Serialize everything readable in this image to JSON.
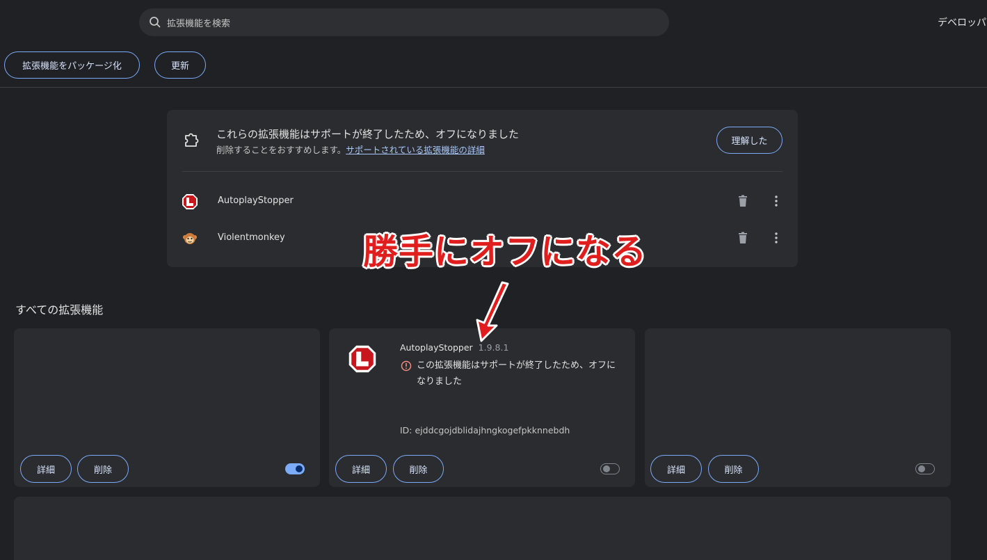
{
  "search": {
    "placeholder": "拡張機能を検索"
  },
  "header": {
    "devmode_label": "デベロッパ"
  },
  "toolbar": {
    "pack_label": "拡張機能をパッケージ化",
    "update_label": "更新"
  },
  "notice": {
    "title": "これらの拡張機能はサポートが終了したため、オフになりました",
    "subtitle": "削除することをおすすめします。",
    "link": "サポートされている拡張機能の詳細",
    "ack_label": "理解した",
    "items": [
      {
        "name": "AutoplayStopper",
        "icon": "autoplaystopper-icon"
      },
      {
        "name": "Violentmonkey",
        "icon": "violentmonkey-icon"
      }
    ]
  },
  "section": {
    "title": "すべての拡張機能"
  },
  "cards": [
    {
      "name": "",
      "version": "",
      "details_label": "詳細",
      "remove_label": "削除",
      "enabled": true
    },
    {
      "name": "AutoplayStopper",
      "version": "1.9.8.1",
      "warning": "この拡張機能はサポートが終了したため、オフになりました",
      "id": "ID: ejddcgojdblidajhngkogefpkknnebdh",
      "details_label": "詳細",
      "remove_label": "削除",
      "enabled": false
    },
    {
      "name": "",
      "version": "",
      "details_label": "詳細",
      "remove_label": "削除",
      "enabled": false
    }
  ],
  "annotation": {
    "text": "勝手にオフになる"
  },
  "colors": {
    "accent": "#7cacf8",
    "background": "#202124",
    "panel": "#2b2c30",
    "annotation": "#e01e1e"
  }
}
